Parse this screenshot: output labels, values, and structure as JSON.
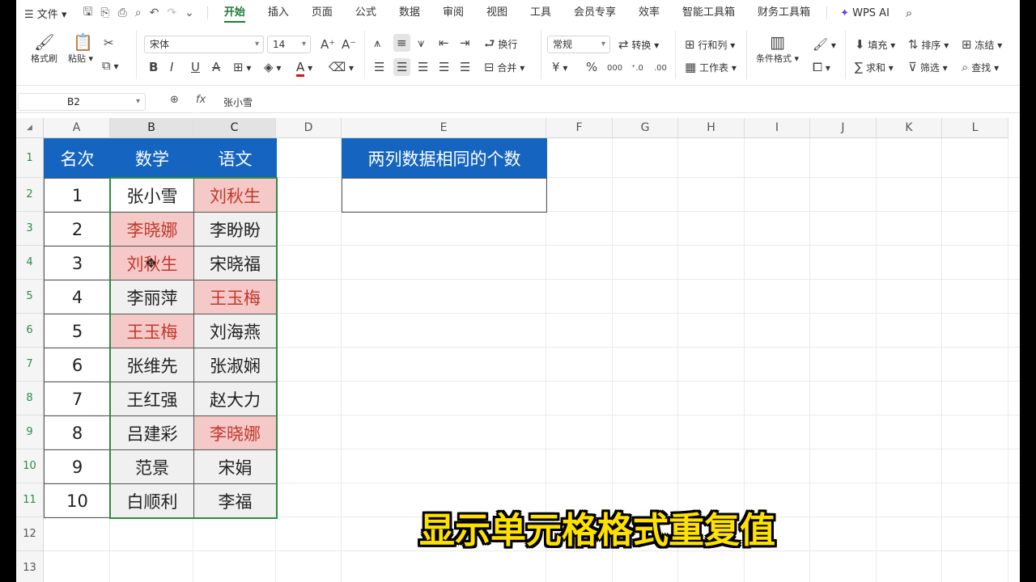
{
  "menubar": {
    "file_label": "文件",
    "tabs": [
      {
        "label": "开始",
        "active": true
      },
      {
        "label": "插入"
      },
      {
        "label": "页面"
      },
      {
        "label": "公式"
      },
      {
        "label": "数据"
      },
      {
        "label": "审阅"
      },
      {
        "label": "视图"
      },
      {
        "label": "工具"
      },
      {
        "label": "会员专享"
      },
      {
        "label": "效率"
      },
      {
        "label": "智能工具箱"
      },
      {
        "label": "财务工具箱"
      }
    ],
    "wps_ai_label": "WPS AI"
  },
  "ribbon": {
    "format_painter": "格式刷",
    "paste": "粘贴",
    "font_name": "宋体",
    "font_size": "14",
    "wrap": "换行",
    "merge": "合并",
    "number_format": "常规",
    "convert": "转换",
    "row_col": "行和列",
    "worksheet": "工作表",
    "conditional_format": "条件格式",
    "fill": "填充",
    "sort": "排序",
    "freeze": "冻结",
    "sum": "求和",
    "filter": "筛选",
    "find": "查找"
  },
  "formula_bar": {
    "name_box": "B2",
    "fx": "fx",
    "content": "张小雪"
  },
  "grid": {
    "columns": [
      "A",
      "B",
      "C",
      "D",
      "E",
      "F",
      "G",
      "H",
      "I",
      "J",
      "K",
      "L"
    ],
    "rows": [
      "1",
      "2",
      "3",
      "4",
      "5",
      "6",
      "7",
      "8",
      "9",
      "10",
      "11",
      "12",
      "13"
    ],
    "table_header": [
      "名次",
      "数学",
      "语文"
    ],
    "table_rows": [
      {
        "rank": "1",
        "math": "张小雪",
        "chinese": "刘秋生"
      },
      {
        "rank": "2",
        "math": "李晓娜",
        "chinese": "李盼盼"
      },
      {
        "rank": "3",
        "math": "刘秋生",
        "chinese": "宋晓福"
      },
      {
        "rank": "4",
        "math": "李丽萍",
        "chinese": "王玉梅"
      },
      {
        "rank": "5",
        "math": "王玉梅",
        "chinese": "刘海燕"
      },
      {
        "rank": "6",
        "math": "张维先",
        "chinese": "张淑娴"
      },
      {
        "rank": "7",
        "math": "王红强",
        "chinese": "赵大力"
      },
      {
        "rank": "8",
        "math": "吕建彩",
        "chinese": "李晓娜"
      },
      {
        "rank": "9",
        "math": "范景",
        "chinese": "宋娟"
      },
      {
        "rank": "10",
        "math": "白顺利",
        "chinese": "李福"
      }
    ],
    "duplicate_math_rows": [
      2,
      3,
      5
    ],
    "duplicate_chinese_rows": [
      1,
      4,
      8
    ],
    "count_header": "两列数据相同的个数",
    "count_value": "",
    "header_color": "#1565c0",
    "duplicate_fill": "#f6c9c9",
    "duplicate_text": "#c0392b"
  },
  "caption": "显示单元格格式重复值"
}
